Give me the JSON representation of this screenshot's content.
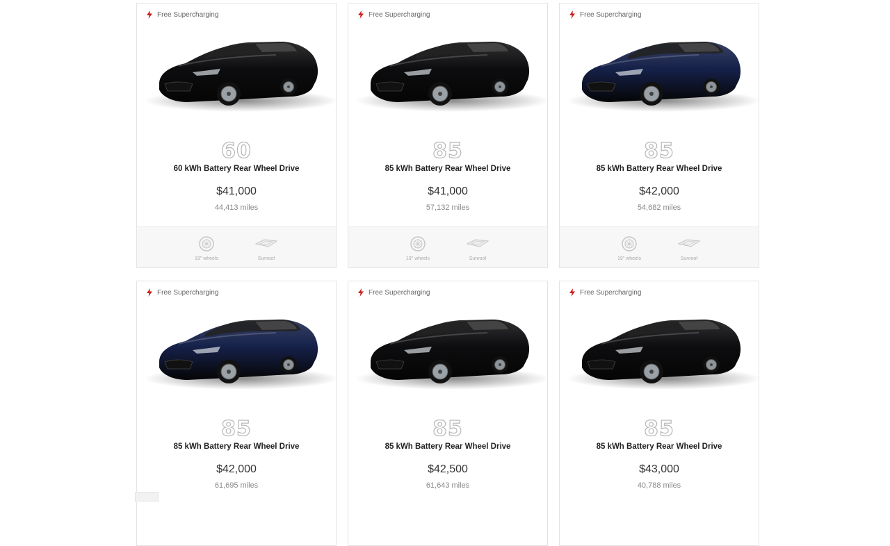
{
  "supercharging_label": "Free Supercharging",
  "feature_labels": {
    "wheels": "19\" wheels",
    "sunroof": "Sunroof"
  },
  "listings": [
    {
      "badge": "60",
      "name": "60 kWh Battery Rear Wheel Drive",
      "price": "$41,000",
      "miles": "44,413 miles",
      "car_color": "#0d0d0f"
    },
    {
      "badge": "85",
      "name": "85 kWh Battery Rear Wheel Drive",
      "price": "$41,000",
      "miles": "57,132 miles",
      "car_color": "#0d0d0f"
    },
    {
      "badge": "85",
      "name": "85 kWh Battery Rear Wheel Drive",
      "price": "$42,000",
      "miles": "54,682 miles",
      "car_color": "#16214a"
    },
    {
      "badge": "85",
      "name": "85 kWh Battery Rear Wheel Drive",
      "price": "$42,000",
      "miles": "61,695 miles",
      "car_color": "#16214a"
    },
    {
      "badge": "85",
      "name": "85 kWh Battery Rear Wheel Drive",
      "price": "$42,500",
      "miles": "61,643 miles",
      "car_color": "#0d0d0f"
    },
    {
      "badge": "85",
      "name": "85 kWh Battery Rear Wheel Drive",
      "price": "$43,000",
      "miles": "40,788 miles",
      "car_color": "#0d0d0f"
    }
  ],
  "colors": {
    "supercharging_icon": "#cc1f1f",
    "badge_outline": "#b6b6b6",
    "card_border": "#e3e3e3",
    "features_bg": "#f7f7f7"
  },
  "icons": {
    "supercharging": "lightning-bolt-icon",
    "wheels": "wheel-icon",
    "sunroof": "sunroof-icon"
  }
}
